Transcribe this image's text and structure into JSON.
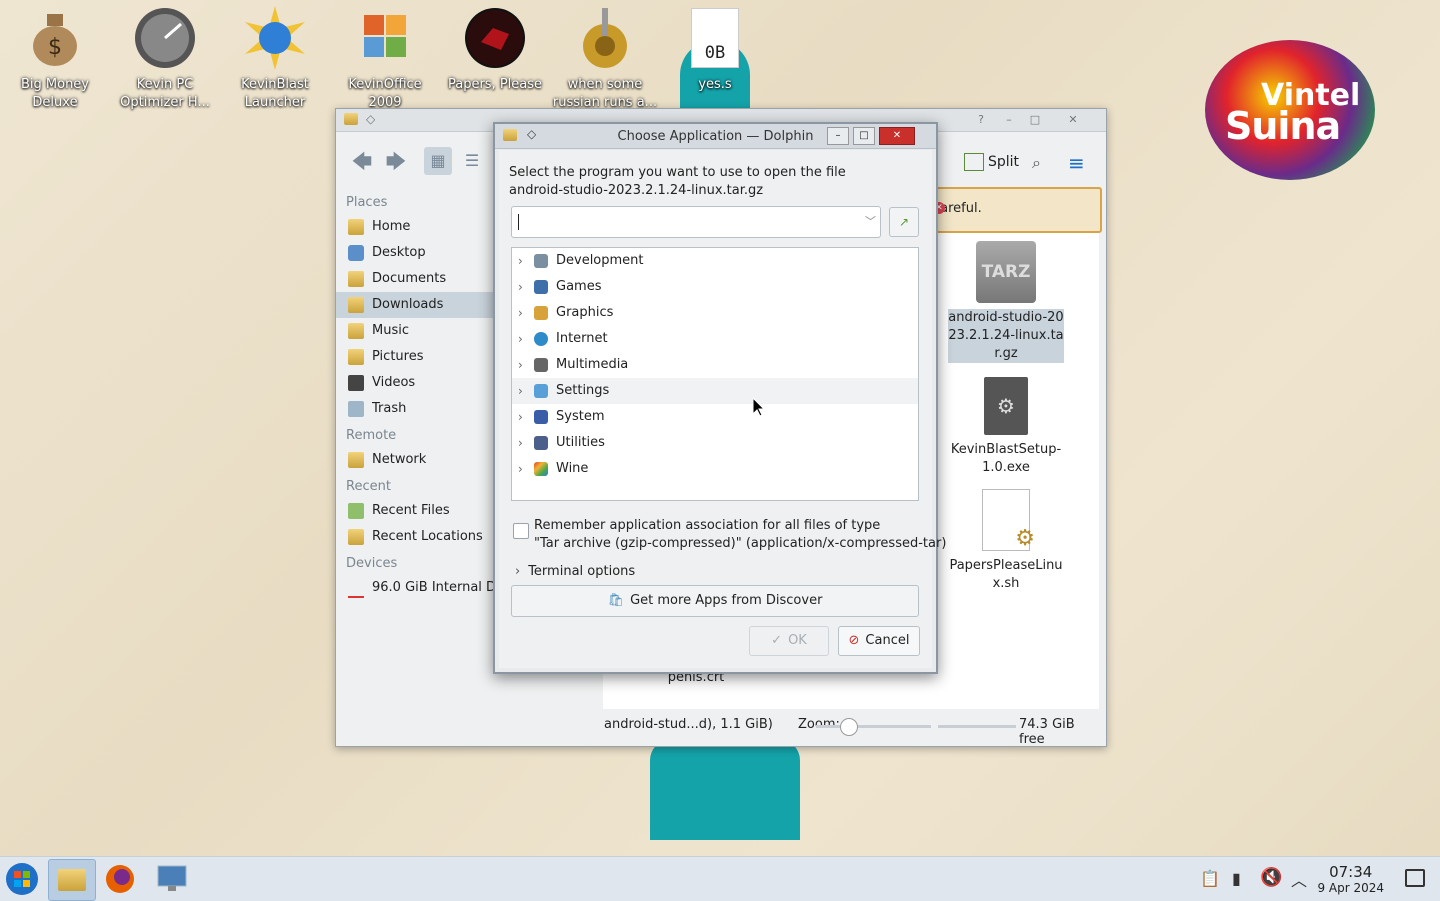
{
  "desktop": {
    "icons": [
      {
        "label": "Big Money\nDeluxe"
      },
      {
        "label": "Kevin PC\nOptimizer H..."
      },
      {
        "label": "KevinBlast\nLauncher"
      },
      {
        "label": "KevinOffice\n2009"
      },
      {
        "label": "Papers, Please"
      },
      {
        "label": "when some\nrussian runs a..."
      },
      {
        "label": "yes.s",
        "preview": "0B"
      }
    ],
    "logo_line1": "Vintel",
    "logo_line2": "Suina"
  },
  "dolphin": {
    "split_label": "Split",
    "places_header": "Places",
    "places": [
      "Home",
      "Desktop",
      "Documents",
      "Downloads",
      "Music",
      "Pictures",
      "Videos",
      "Trash"
    ],
    "remote_header": "Remote",
    "remote": [
      "Network"
    ],
    "recent_header": "Recent",
    "recent": [
      "Recent Files",
      "Recent Locations"
    ],
    "devices_header": "Devices",
    "devices": [
      "96.0 GiB Internal Dri"
    ],
    "banner_text": "careful.",
    "files": [
      {
        "name": "android-studio-2023.2.1.24-linux.tar.gz",
        "icon_text": "TARZ"
      },
      {
        "name": "KevinBlastSetup-1.0.exe"
      },
      {
        "name": "PapersPleaseLinux.sh"
      },
      {
        "name": "penis.crt"
      }
    ],
    "status_text": "android-stud...d), 1.1 GiB)",
    "zoom_label": "Zoom:",
    "free_space": "74.3 GiB free"
  },
  "dialog": {
    "title": "Choose Application — Dolphin",
    "prompt_line1": "Select the program you want to use to open the file",
    "prompt_line2": "android-studio-2023.2.1.24-linux.tar.gz",
    "combo_value": "",
    "categories": [
      "Development",
      "Games",
      "Graphics",
      "Internet",
      "Multimedia",
      "Settings",
      "System",
      "Utilities",
      "Wine"
    ],
    "remember_line1": "Remember application association for all files of type",
    "remember_line2": "\"Tar archive (gzip-compressed)\" (application/x-compressed-tar)",
    "terminal_options": "Terminal options",
    "discover_button": "Get more Apps from Discover",
    "ok_label": "OK",
    "cancel_label": "Cancel"
  },
  "taskbar": {
    "time": "07:34",
    "date": "9 Apr 2024"
  },
  "colors": {
    "selection": "#c9d3db",
    "banner_border": "#d8a44a",
    "accent": "#1e6fc7",
    "mascot": "#14a3a9"
  }
}
